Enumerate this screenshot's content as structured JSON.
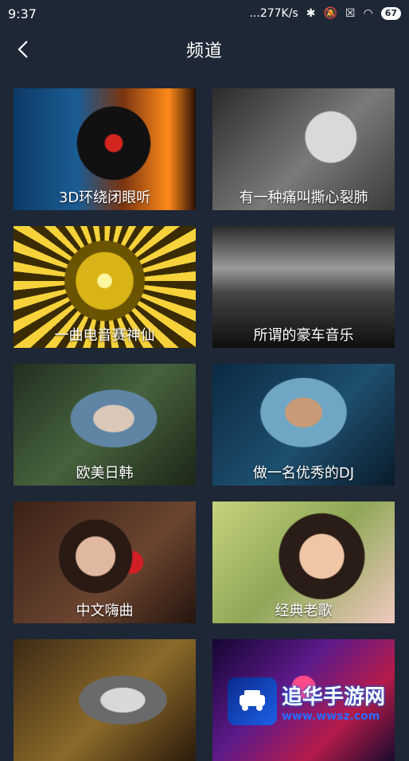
{
  "status_bar": {
    "time": "9:37",
    "network_speed": "...277K/s",
    "battery": "67"
  },
  "nav": {
    "title": "频道"
  },
  "channels": [
    {
      "label": "3D环绕闭眼听"
    },
    {
      "label": "有一种痛叫撕心裂肺"
    },
    {
      "label": "一曲电音赛神仙"
    },
    {
      "label": "所谓的豪车音乐"
    },
    {
      "label": "欧美日韩"
    },
    {
      "label": "做一名优秀的DJ"
    },
    {
      "label": "中文嗨曲"
    },
    {
      "label": "经典老歌"
    },
    {
      "label": ""
    },
    {
      "label": ""
    }
  ],
  "watermark": {
    "name": "追华手游网",
    "url": "www.wwsz.com"
  }
}
